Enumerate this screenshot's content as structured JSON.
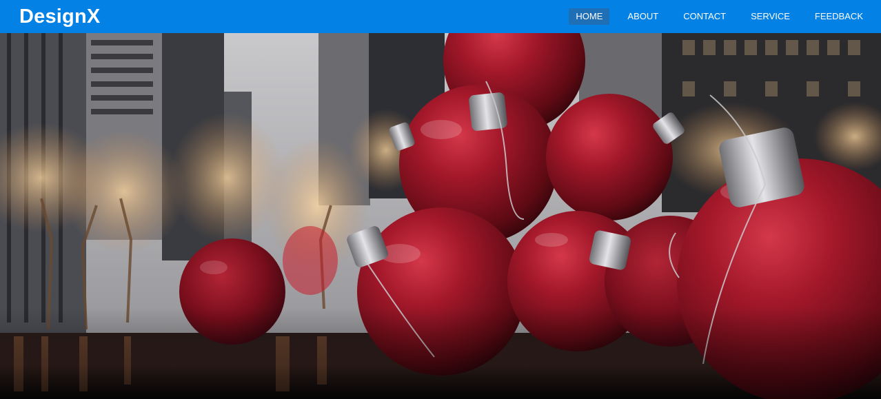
{
  "navbar": {
    "brand": "DesignX",
    "items": [
      {
        "label": "HOME",
        "active": true
      },
      {
        "label": "ABOUT",
        "active": false
      },
      {
        "label": "CONTACT",
        "active": false
      },
      {
        "label": "SERVICE",
        "active": false
      },
      {
        "label": "FEEDBACK",
        "active": false
      }
    ]
  },
  "colors": {
    "navbar_bg": "#0481e4",
    "active_item_bg": "#1f6fb6",
    "text": "#ffffff",
    "ornament_red": "#8e0f1e"
  },
  "hero": {
    "image_subject": "hero-photo-christmas-ornaments"
  }
}
